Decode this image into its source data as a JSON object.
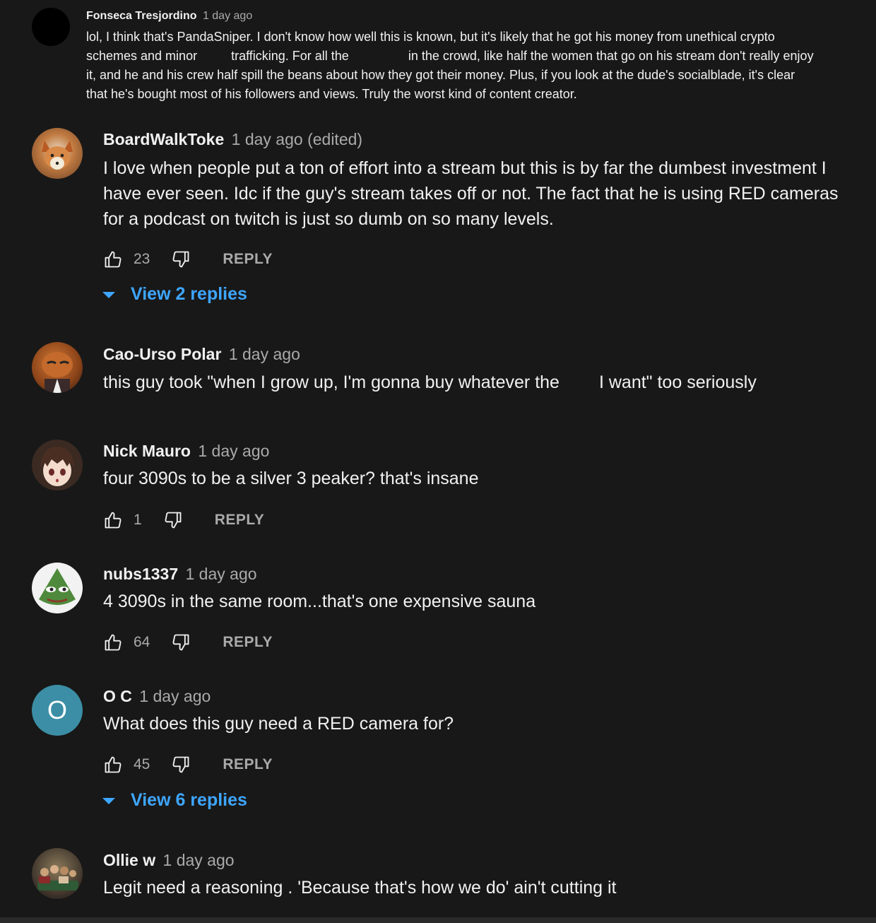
{
  "comments": [
    {
      "author": "Fonseca Tresjordino",
      "time": "1 day ago",
      "avatar_color": "#000000",
      "lines": [
        [
          "lol, I think that's PandaSniper. I don't know how well this is known, but it's likely that he got his money from unethical crypto"
        ],
        [
          "schemes and minor",
          "trafficking. For all the",
          "in the crowd, like half the women that go on his stream don't really enjoy"
        ],
        [
          "it, and he and his crew half spill the beans about how they got their money. Plus, if you look at the dude's socialblade, it's clear"
        ],
        [
          "that he's bought most of his followers and views. Truly the worst kind of content creator."
        ]
      ]
    },
    {
      "author": "BoardWalkToke",
      "time": "1 day ago (edited)",
      "avatar_color": "#a86a3a",
      "lines": [
        "I love when people put a ton of effort into a stream but this is by far the dumbest investment I",
        "have ever seen. Idc if the guy's stream takes off or not. The fact that he is using RED cameras",
        "for a podcast on twitch is just so dumb on so many levels."
      ],
      "likes": "23",
      "reply_label": "REPLY",
      "view_replies": "View 2 replies"
    },
    {
      "author": "Cao-Urso Polar",
      "time": "1 day ago",
      "avatar_color": "#8a4a20",
      "text_before": "this guy took \"when I grow up, I'm gonna buy whatever the",
      "text_after": "I want\" too seriously"
    },
    {
      "author": "Nick Mauro",
      "time": "1 day ago",
      "avatar_color": "#3a2a22",
      "text": "four 3090s to be a silver 3 peaker? that's insane",
      "likes": "1",
      "reply_label": "REPLY"
    },
    {
      "author": "nubs1337",
      "time": "1 day ago",
      "avatar_color": "#4e8a3a",
      "text": "4 3090s in the same room...that's one expensive sauna",
      "likes": "64",
      "reply_label": "REPLY"
    },
    {
      "author": "O C",
      "time": "1 day ago",
      "avatar_color": "#3b8ea5",
      "avatar_letter": "O",
      "text": "What does this guy need a RED camera for?",
      "likes": "45",
      "reply_label": "REPLY",
      "view_replies": "View 6 replies"
    },
    {
      "author": "Ollie w",
      "time": "1 day ago",
      "avatar_color": "#5a4a3a",
      "text": "Legit need a reasoning . 'Because that's how we do' ain't cutting it"
    }
  ],
  "icons": {
    "like": "thumbs-up-icon",
    "dislike": "thumbs-down-icon",
    "expand": "caret-down-icon"
  },
  "colors": {
    "background": "#181818",
    "text": "#f1f1f1",
    "muted": "#aaaaaa",
    "link": "#3ea6ff"
  }
}
